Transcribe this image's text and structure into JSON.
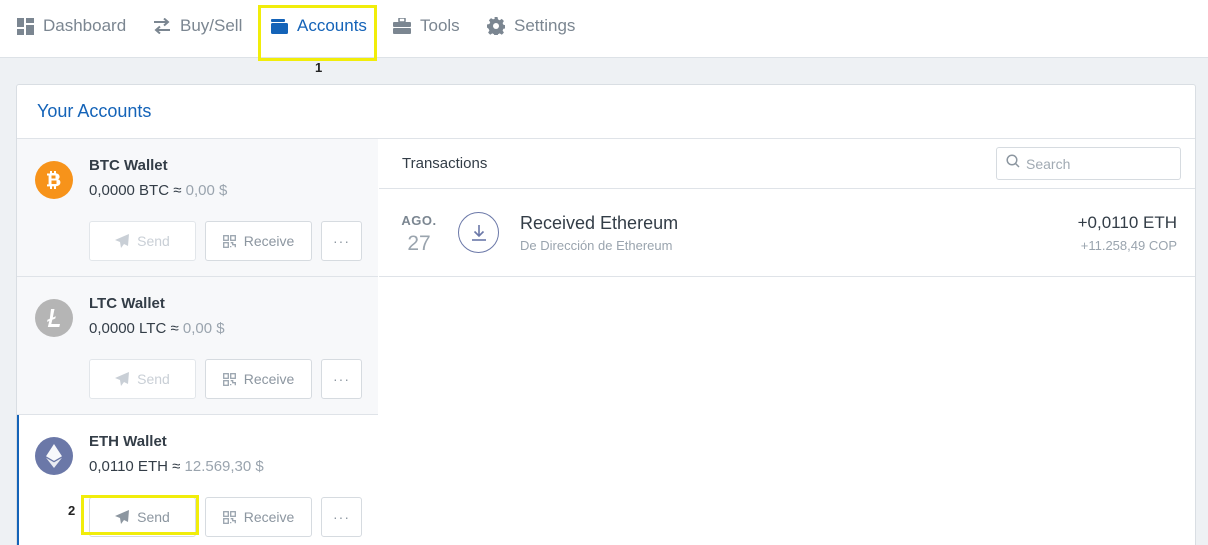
{
  "nav": {
    "items": [
      {
        "label": "Dashboard",
        "icon": "dashboard-icon"
      },
      {
        "label": "Buy/Sell",
        "icon": "swap-icon"
      },
      {
        "label": "Accounts",
        "icon": "wallet-icon",
        "active": true
      },
      {
        "label": "Tools",
        "icon": "toolbox-icon"
      },
      {
        "label": "Settings",
        "icon": "gear-icon"
      }
    ]
  },
  "annotations": {
    "callout_1": "1",
    "callout_2": "2",
    "highlight_color": "#f1ed0a"
  },
  "panel": {
    "title": "Your Accounts"
  },
  "accounts": [
    {
      "name": "BTC Wallet",
      "amount": "0,0000 BTC",
      "approx": "≈",
      "fiat": "0,00 $",
      "coin_color": "#f7931a",
      "coin_icon": "bitcoin-icon",
      "send_label": "Send",
      "receive_label": "Receive",
      "more_label": "···",
      "send_disabled": true
    },
    {
      "name": "LTC Wallet",
      "amount": "0,0000 LTC",
      "approx": "≈",
      "fiat": "0,00 $",
      "coin_color": "#b5b5b5",
      "coin_icon": "litecoin-icon",
      "send_label": "Send",
      "receive_label": "Receive",
      "more_label": "···",
      "send_disabled": true
    },
    {
      "name": "ETH Wallet",
      "amount": "0,0110 ETH",
      "approx": "≈",
      "fiat": "12.569,30 $",
      "coin_color": "#6b78a8",
      "coin_icon": "ethereum-icon",
      "send_label": "Send",
      "receive_label": "Receive",
      "more_label": "···",
      "send_disabled": false,
      "selected": true
    }
  ],
  "transactions": {
    "title": "Transactions",
    "search_placeholder": "Search",
    "items": [
      {
        "month": "AGO.",
        "day": "27",
        "title": "Received Ethereum",
        "subtitle": "De Dirección de Ethereum",
        "amount": "+0,0110 ETH",
        "fiat": "+11.258,49 COP",
        "icon": "receive-arrow-icon"
      }
    ]
  },
  "colors": {
    "accent": "#1463b8",
    "highlight": "#f1ed0a",
    "eth": "#6b78a8",
    "btc": "#f7931a",
    "ltc": "#b5b5b5"
  }
}
